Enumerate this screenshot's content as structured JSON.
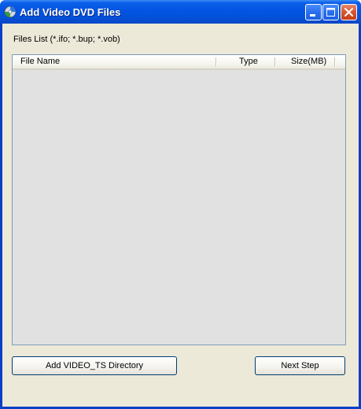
{
  "window": {
    "title": "Add Video DVD Files",
    "icon": "dvd-disc-icon"
  },
  "titlebar_buttons": {
    "minimize": "minimize-icon",
    "maximize": "maximize-icon",
    "close": "close-icon"
  },
  "files_list": {
    "label": "Files List (*.ifo; *.bup; *.vob)",
    "columns": [
      "File Name",
      "Type",
      "Size(MB)"
    ],
    "rows": []
  },
  "buttons": {
    "add_directory": "Add VIDEO_TS Directory",
    "next_step": "Next Step"
  },
  "colors": {
    "titlebar": "#0454e3",
    "client_bg": "#ece9d8",
    "list_bg": "#e1e1e1"
  }
}
